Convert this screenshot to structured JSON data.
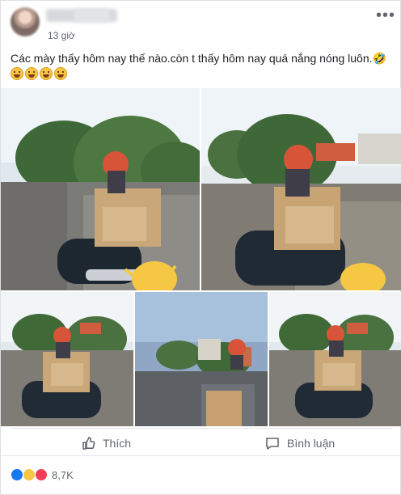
{
  "post": {
    "author_name": "",
    "timestamp": "13 giờ",
    "more_label": "•••",
    "caption": "Các mày thấy hôm nay thế nào.còn t thấy hôm nay quá nắng nóng luôn.🤣",
    "caption_emojis": [
      "rolling-on-floor-laughing",
      "rolling-on-floor-laughing",
      "rolling-on-floor-laughing",
      "rolling-on-floor-laughing"
    ]
  },
  "actions": {
    "like_label": "Thích",
    "comment_label": "Bình luận"
  },
  "reactions": {
    "types": [
      "like",
      "haha",
      "love"
    ],
    "count": "8,7K"
  },
  "colors": {
    "facebook_blue": "#1877f2",
    "gray_text": "#606770",
    "border": "#dddfe2"
  }
}
